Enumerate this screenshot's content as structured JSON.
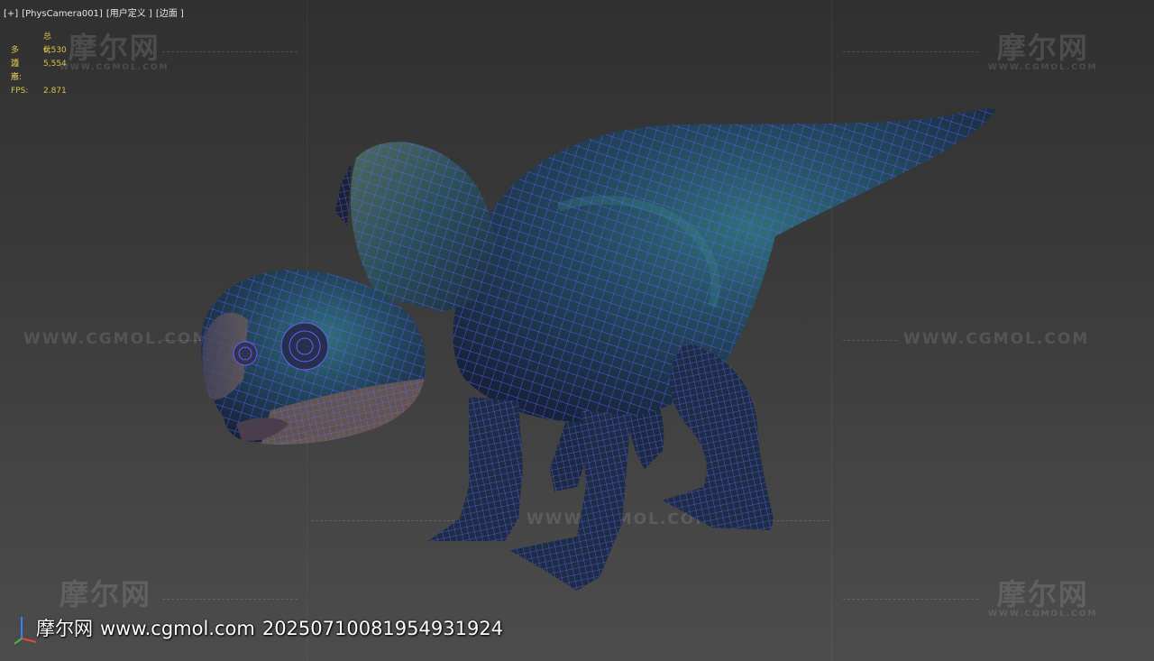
{
  "viewport": {
    "label_plus": "[+]",
    "label_camera": "[PhysCamera001]",
    "label_view": "[用户定义 ]",
    "label_shading": "[边面 ]"
  },
  "stats": {
    "header": "总计",
    "polygons_label": "多边形:",
    "polygons_value": "6,530",
    "vertices_label": "顶点:",
    "vertices_value": "5,554",
    "fps_label": "FPS:",
    "fps_value": "2.871"
  },
  "watermark": {
    "logo_text": "摩尔网",
    "logo_sub": "WWW.CGMOL.COM",
    "url_text": "WWW.CGMOL.COM"
  },
  "stamp": {
    "site_name": "摩尔网",
    "site_url": "www.cgmol.com",
    "id_number": "20250710081954931924"
  },
  "colors": {
    "wireframe": "#6a5cff",
    "stats_text": "#d8c24a",
    "skin_dark": "#1d3550",
    "skin_teal": "#2f6f7a"
  }
}
